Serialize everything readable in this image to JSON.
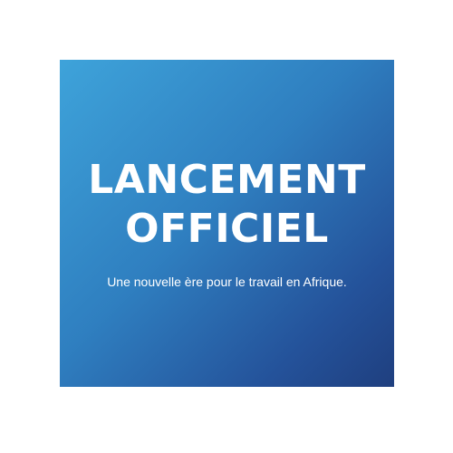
{
  "banner": {
    "headline_line1": "LANCEMENT",
    "headline_line2": "OFFICIEL",
    "subtitle": "Une nouvelle ère pour le travail en Afrique.",
    "gradient_colors": [
      "#3ea3da",
      "#2f7fc0",
      "#24529a",
      "#1f3f7f"
    ],
    "text_color": "#ffffff"
  }
}
